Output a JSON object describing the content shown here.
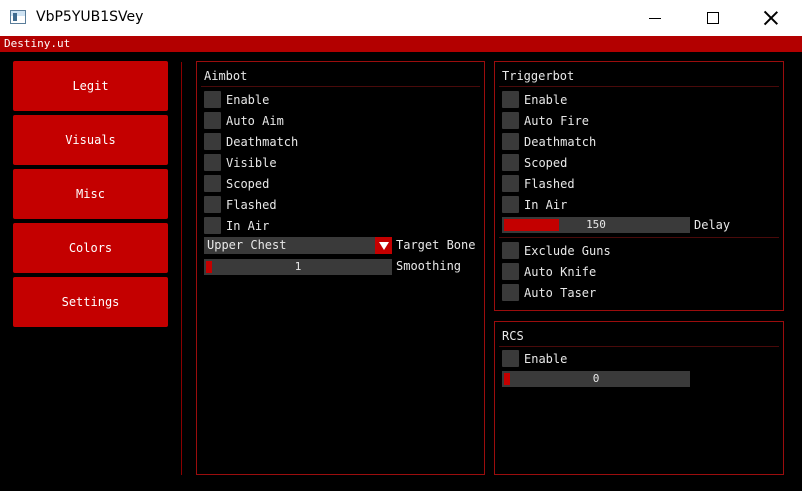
{
  "window": {
    "title": "VbP5YUB1SVey"
  },
  "app": {
    "title": "Destiny.ut"
  },
  "nav": [
    "Legit",
    "Visuals",
    "Misc",
    "Colors",
    "Settings"
  ],
  "aimbot": {
    "title": "Aimbot",
    "checkboxes": [
      "Enable",
      "Auto Aim",
      "Deathmatch",
      "Visible",
      "Scoped",
      "Flashed",
      "In Air"
    ],
    "target_bone": {
      "value": "Upper Chest",
      "label": "Target Bone"
    },
    "smoothing": {
      "value": "1",
      "label": "Smoothing",
      "fraction": 0.0
    }
  },
  "triggerbot": {
    "title": "Triggerbot",
    "checkboxes": [
      "Enable",
      "Auto Fire",
      "Deathmatch",
      "Scoped",
      "Flashed",
      "In Air"
    ],
    "delay": {
      "value": "150",
      "label": "Delay",
      "fraction": 0.3
    },
    "extra_checkboxes": [
      "Exclude Guns",
      "Auto Knife",
      "Auto Taser"
    ]
  },
  "rcs": {
    "title": "RCS",
    "checkboxes": [
      "Enable"
    ],
    "amount": {
      "value": "0",
      "fraction": 0.0
    }
  }
}
